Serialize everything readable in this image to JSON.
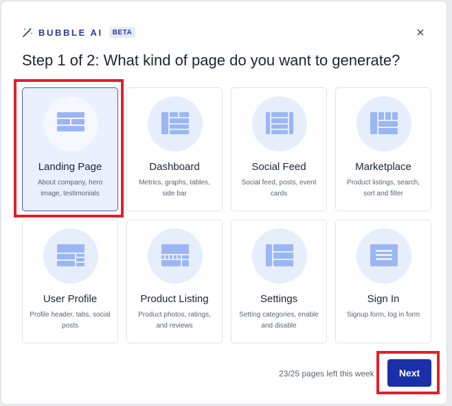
{
  "header": {
    "icon": "magic-wand-icon",
    "brand": "BUBBLE AI",
    "badge": "BETA",
    "close_icon": "close-icon"
  },
  "title": "Step 1 of 2: What kind of page do you want to generate?",
  "cards": [
    {
      "title": "Landing Page",
      "desc": "About company, hero image, testimonials",
      "icon": "landing-page-layout-icon",
      "selected": true
    },
    {
      "title": "Dashboard",
      "desc": "Metrics, graphs, tables, side bar",
      "icon": "dashboard-layout-icon",
      "selected": false
    },
    {
      "title": "Social Feed",
      "desc": "Social feed, posts, event cards",
      "icon": "social-feed-layout-icon",
      "selected": false
    },
    {
      "title": "Marketplace",
      "desc": "Product listings, search, sort and filter",
      "icon": "marketplace-layout-icon",
      "selected": false
    },
    {
      "title": "User Profile",
      "desc": "Profile header, tabs, social posts",
      "icon": "user-profile-layout-icon",
      "selected": false
    },
    {
      "title": "Product Listing",
      "desc": "Product photos, ratings, and reviews",
      "icon": "product-listing-layout-icon",
      "selected": false
    },
    {
      "title": "Settings",
      "desc": "Setting categories, enable and disable",
      "icon": "settings-layout-icon",
      "selected": false
    },
    {
      "title": "Sign In",
      "desc": "Signup form, log in form",
      "icon": "sign-in-layout-icon",
      "selected": false
    }
  ],
  "footer": {
    "pages_left": "23/25 pages left this week",
    "next_label": "Next"
  },
  "colors": {
    "accent": "#1a2fa8",
    "highlight": "#e11f2a",
    "icon": "#9bb6f5",
    "selected_bg": "#eaf0fd"
  }
}
